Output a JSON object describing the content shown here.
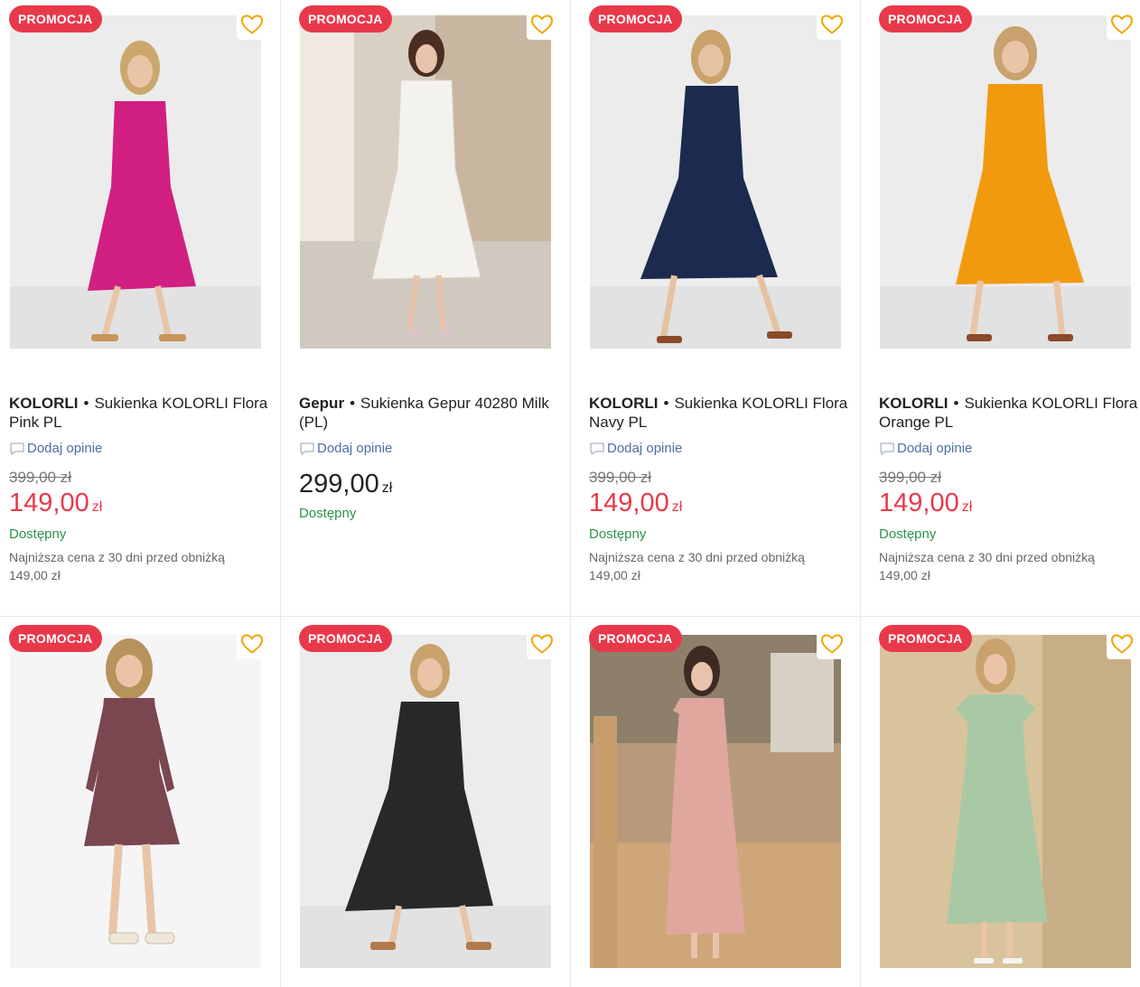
{
  "badge_label": "PROMOCJA",
  "colors": {
    "promo": "#e8394b",
    "heart": "#f0a500",
    "available": "#2b9348",
    "review_link": "#4a6fa5"
  },
  "products": [
    {
      "brand": "KOLORLI",
      "name": "Sukienka KOLORLI Flora Pink PL",
      "review_label": "Dodaj opinie",
      "old_price": "399,00 zł",
      "price": "149,00",
      "currency": "zł",
      "availability": "Dostępny",
      "lowest_price_note": "Najniższa cena z 30 dni przed obniżką",
      "lowest_price_value": "149,00 zł",
      "dress_color": "#d11f82"
    },
    {
      "brand": "Gepur",
      "name": "Sukienka Gepur 40280 Milk (PL)",
      "review_label": "Dodaj opinie",
      "price": "299,00",
      "currency": "zł",
      "availability": "Dostępny",
      "dress_color": "#f4f2ee"
    },
    {
      "brand": "KOLORLI",
      "name": "Sukienka KOLORLI Flora Navy PL",
      "review_label": "Dodaj opinie",
      "old_price": "399,00 zł",
      "price": "149,00",
      "currency": "zł",
      "availability": "Dostępny",
      "lowest_price_note": "Najniższa cena z 30 dni przed obniżką",
      "lowest_price_value": "149,00 zł",
      "dress_color": "#1c2a4f"
    },
    {
      "brand": "KOLORLI",
      "name": "Sukienka KOLORLI Flora Orange PL",
      "review_label": "Dodaj opinie",
      "old_price": "399,00 zł",
      "price": "149,00",
      "currency": "zł",
      "availability": "Dostępny",
      "lowest_price_note": "Najniższa cena z 30 dni przed obniżką",
      "lowest_price_value": "149,00 zł",
      "dress_color": "#f29a0e"
    },
    {
      "dress_color": "#7a4650"
    },
    {
      "dress_color": "#26282a"
    },
    {
      "dress_color": "#e0a79e"
    },
    {
      "dress_color": "#a9c9a4"
    }
  ]
}
